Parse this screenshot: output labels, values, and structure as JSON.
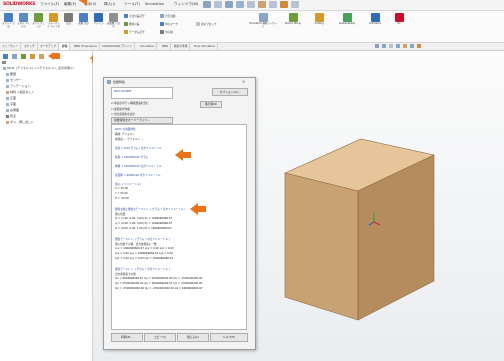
{
  "app": {
    "logo": "SOLIDWORKS",
    "menus": [
      "ファイル(F)",
      "編集(E)",
      "表示(V)",
      "挿入(I)",
      "ツール(T)",
      "Simulation",
      "ウィンドウ(W)"
    ]
  },
  "ribbon": {
    "buttons": [
      {
        "label": "スマート\n寸法",
        "icon": "smart-dimension-icon",
        "color": "#4a7fc1"
      },
      {
        "label": "モデル\nアイテム",
        "icon": "model-items-icon",
        "color": "#5b8cc7"
      },
      {
        "label": "スペル\nチェック",
        "icon": "spell-check-icon",
        "color": "#6e9b3c"
      },
      {
        "label": "フォーマット\nペインタ",
        "icon": "format-painter-icon",
        "color": "#d19a2a"
      },
      {
        "label": "注記",
        "icon": "note-icon",
        "color": "#7a7a7a"
      },
      {
        "label": "直線\n注記",
        "icon": "linear-note-icon",
        "color": "#4a7fc1"
      },
      {
        "label": "バルーン",
        "icon": "balloon-icon",
        "color": "#2f6db3"
      },
      {
        "label": "表面粗さ\n記号",
        "icon": "surface-finish-icon",
        "color": "#8f8f8f"
      }
    ],
    "rows": [
      "寸法公差記号",
      "幾何公差",
      "データム記号",
      "穴引出線",
      "中心マーク",
      "中心線",
      "表示ブロック"
    ],
    "right_buttons": [
      "Simulation\n解析ウィザード",
      "Motion\nStudy",
      "Costing",
      "Sustainability",
      "DimXpert",
      "Rx"
    ]
  },
  "tabs": [
    "フィーチャー",
    "スケッチ",
    "マークアップ",
    "評価",
    "MBD Dimensions",
    "SOLIDWORKS アドイン",
    "Simulation",
    "MBD",
    "解析の準備",
    "Flow Simulation"
  ],
  "active_tab": 3,
  "tree": {
    "items": [
      "Part1 (デフォルト) <<デフォルト>_表示状態1>",
      "履歴",
      "センサー",
      "アノテーション",
      "材料 <指定なし>",
      "正面",
      "平面",
      "右側面",
      "原点",
      "ボス - 押し出し1"
    ]
  },
  "dialog": {
    "title": "質量特性",
    "field_text": "Part1.SLDPRT",
    "options_label": "オプション(O)...",
    "recalc_label": "再計算(R)",
    "checks": [
      "非表示ボディ/構成部品を含む",
      "座標系を作成",
      "出力座標系を表示",
      "ボディ/構成部品を含む"
    ],
    "override": "質量特性をオーバーライド...",
    "results": [
      "Part1 の質量特性",
      "  構成: デフォルト",
      "  座標系: -- デフォルト --",
      "密度 = 0.00 グラム / 立方ミリメートル",
      "質量 = 1000000.00 グラム",
      "体積 = 1000000.00 立方ミリメートル",
      "表面積 = 60000.00 平方ミリメートル",
      "重心: ( ミリメートル )",
      "  X = 50.00",
      "  Y = 50.00",
      "  Z = -50.00",
      "慣性主軸と慣性主モーメント: ( グラム * 平方ミリメートル )",
      "重心位置",
      "  Ix = (1.00, 0.00, 0.00)   Px = 1666666666.67",
      "  Iy = (0.00, 1.00, 0.00)   Py = 1666666666.67",
      "  Iz = (0.00, 0.00, 1.00)   Pz = 1666666666.67",
      "慣性モーメント: ( グラム * 平方ミリメートル )",
      "重心位置での値、出力座標系に一致",
      "  Lxx = 1666666666.67   Lxy = 0.00   Lxz = 0.00",
      "  Lyx = 0.00   Lyy = 1666666666.67   Lyz = 0.00",
      "  Lzx = 0.00   Lzy = 0.00   Lzz = 1666666666.67",
      "慣性モーメント: ( グラム * 平方ミリメートル )",
      "出力座標系での値",
      "  Ixx = 6666666666.67   Ixy = 2500000000.00   Ixz = -2500000000.00",
      "  Iyx = 2500000000.00   Iyy = 6666666666.67   Iyz = -2500000000.00",
      "  Izx = -2500000000.00  Izy = -2500000000.00  Izz = 6666666666.67"
    ],
    "buttons": [
      "印刷(P)...",
      "コピー(C)",
      "閉じる(L)",
      "ヘルプ(H)"
    ]
  },
  "colors": {
    "accent": "#e8731a",
    "cube_top": "#e6c59a",
    "cube_left": "#c9a274",
    "cube_right": "#b58c5e",
    "brand": "#c8102e"
  }
}
